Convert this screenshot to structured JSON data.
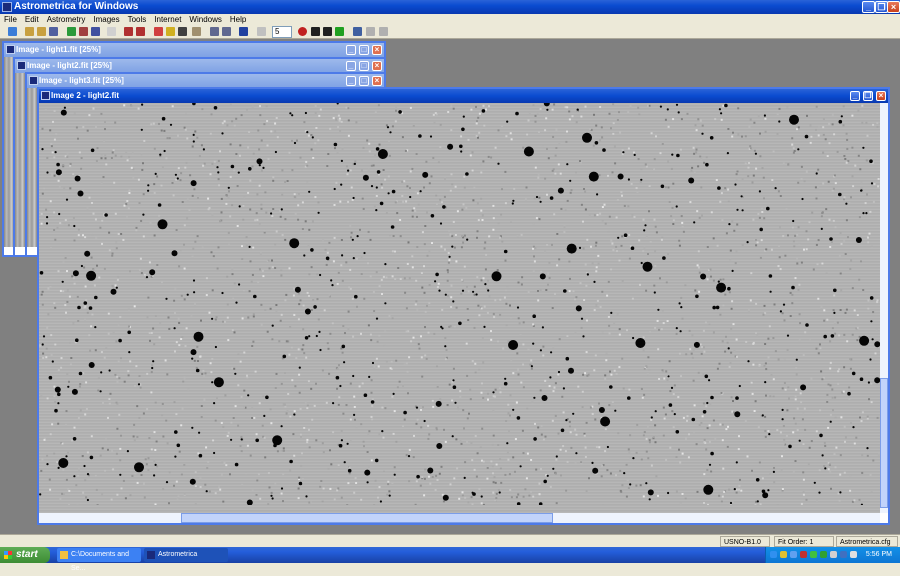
{
  "app": {
    "title": "Astrometrica for Windows"
  },
  "menu": [
    "File",
    "Edit",
    "Astrometry",
    "Images",
    "Tools",
    "Internet",
    "Windows",
    "Help"
  ],
  "toolbar": {
    "spin_value": "5"
  },
  "windows": [
    {
      "title": "Image - light1.fit [25%]"
    },
    {
      "title": "Image - light2.fit [25%]"
    },
    {
      "title": "Image - light3.fit [25%]"
    }
  ],
  "active_window": {
    "title": "Image 2 - light2.fit"
  },
  "statusbar": {
    "catalog": "USNO-B1.0",
    "fit_order": "Fit Order: 1",
    "config": "Astrometrica.cfg"
  },
  "taskbar": {
    "start": "start",
    "tasks": [
      "C:\\Documents and Se...",
      "Astrometrica"
    ],
    "clock": "5:56 PM"
  },
  "colors": {
    "xp_blue": "#0a4bd0",
    "inactive_blue": "#7ea1e4",
    "start_green": "#3c8c33"
  }
}
